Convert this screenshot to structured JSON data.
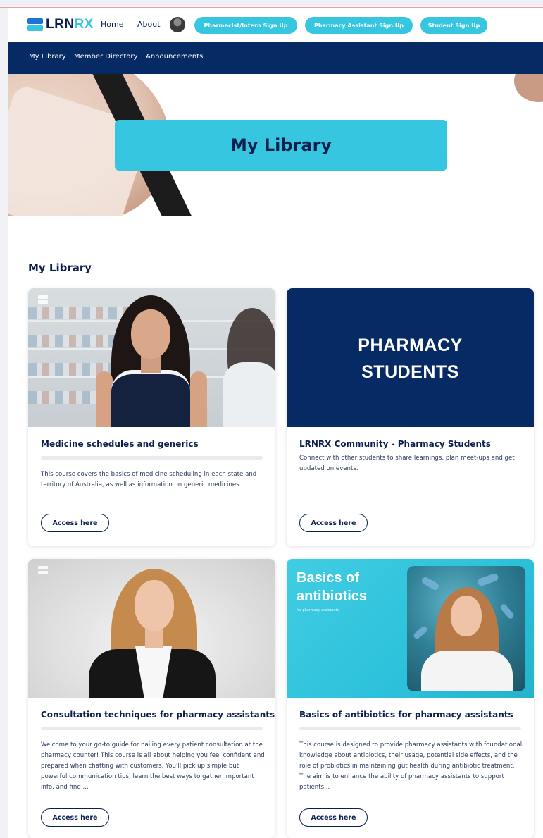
{
  "header": {
    "logo_part1": "LRN",
    "logo_part2": "RX",
    "nav": [
      "Home",
      "About"
    ],
    "signups": [
      "Pharmacist/Intern Sign Up",
      "Pharmacy Assistant Sign Up",
      "Student Sign Up"
    ]
  },
  "subnav": [
    "My Library",
    "Member Directory",
    "Announcements"
  ],
  "hero": {
    "title": "My Library"
  },
  "section": {
    "title": "My Library"
  },
  "cards": [
    {
      "title": "Medicine schedules and generics",
      "description": "This course covers the basics of medicine scheduling in each state and territory of Australia, as well as information on generic medicines.",
      "button": "Access here"
    },
    {
      "title": "LRNRX Community - Pharmacy Students",
      "description": "Connect with other students to share learnings, plan meet-ups and get updated on events.",
      "button": "Access here",
      "image_text_1": "PHARMACY",
      "image_text_2": "STUDENTS"
    },
    {
      "title": "Consultation techniques for pharmacy assistants",
      "description": "Welcome to your go-to guide for nailing every patient consultation at the pharmacy counter! This course is all about helping you feel confident and prepared when chatting with customers. You'll pick up simple but powerful communication tips, learn the best ways to gather important info, and find ...",
      "button": "Access here"
    },
    {
      "title": "Basics of antibiotics for pharmacy assistants",
      "description": "This course is designed to provide pharmacy assistants with foundational knowledge about antibiotics, their usage, potential side effects, and the role of probiotics in maintaining gut health during antibiotic treatment. The aim is to enhance the ability of pharmacy assistants to support patients...",
      "button": "Access here",
      "image_text_1": "Basics of",
      "image_text_2": "antibiotics",
      "image_sub": "for pharmacy assistants"
    }
  ],
  "colors": {
    "navy": "#062a63",
    "teal": "#36c6e0",
    "text": "#0b1f4f"
  }
}
